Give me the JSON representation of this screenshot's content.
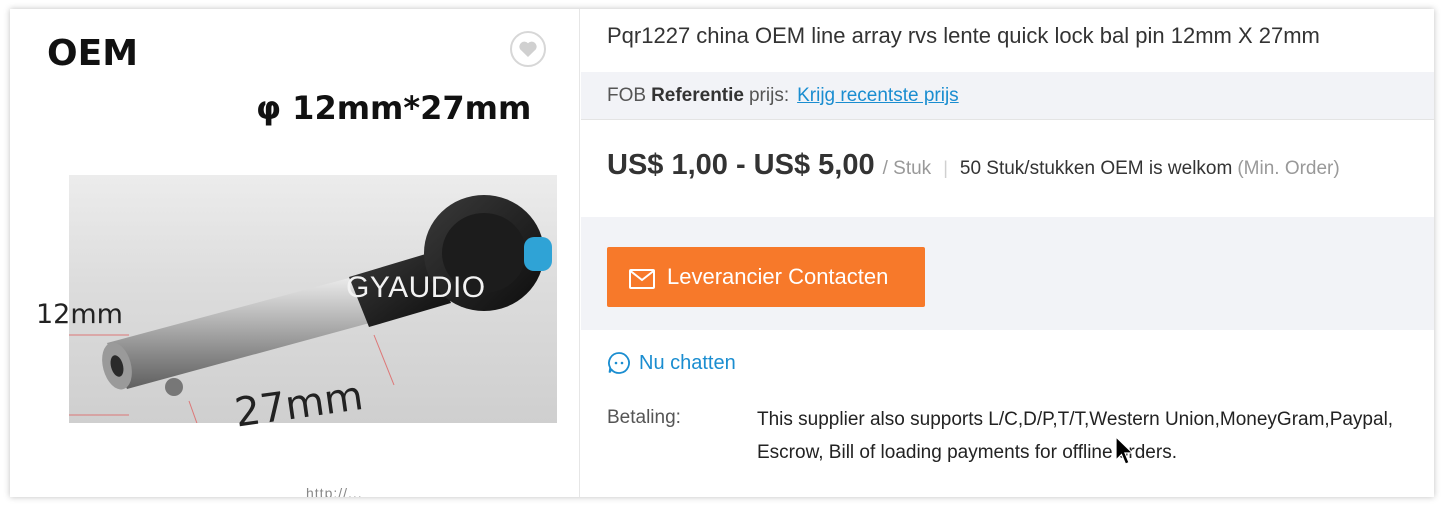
{
  "product_image": {
    "brand_text": "OEM",
    "dimension_text": "φ 12mm*27mm",
    "watermark": "GYAUDIO",
    "label_diameter": "12mm",
    "label_length": "27mm",
    "bottom_url_fragment": "http://...",
    "favorite_icon": "heart-icon"
  },
  "product": {
    "title": "Pqr1227 china OEM line array rvs lente quick lock bal pin 12mm X 27mm"
  },
  "fob": {
    "prefix": "FOB",
    "bold": "Referentie",
    "suffix": "prijs:",
    "link": "Krijg recentste prijs"
  },
  "pricing": {
    "range": "US$ 1,00 - US$ 5,00",
    "unit": "/ Stuk",
    "separator": "|",
    "moq": "50 Stuk/stukken OEM is welkom",
    "moq_note": "(Min. Order)"
  },
  "contact": {
    "button_label": "Leverancier Contacten",
    "icon": "envelope-icon"
  },
  "chat": {
    "label": "Nu chatten",
    "icon": "chat-bubble-icon"
  },
  "payment": {
    "label": "Betaling:",
    "text": "This supplier also supports L/C,D/P,T/T,Western Union,MoneyGram,Paypal, Escrow, Bill of loading payments for offline orders."
  },
  "colors": {
    "accent_orange": "#f7792a",
    "link_blue": "#1a8dd0",
    "panel_gray": "#f2f3f7"
  }
}
